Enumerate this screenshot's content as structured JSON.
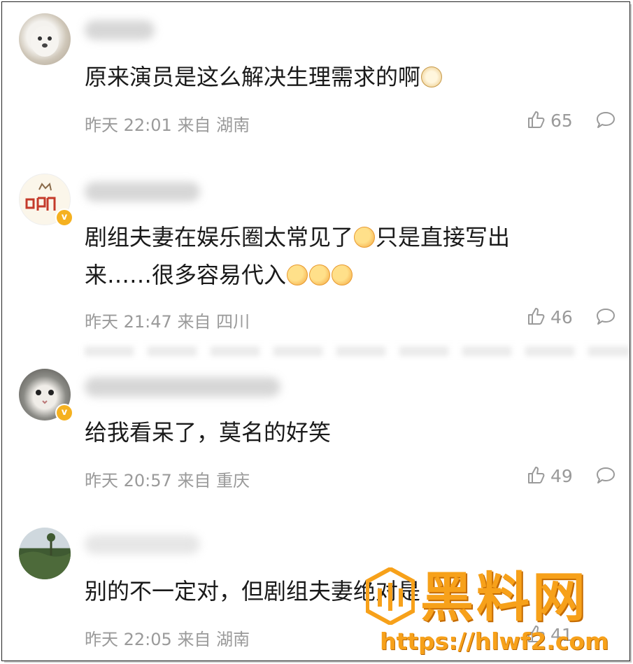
{
  "comments": [
    {
      "text": "原来演员是这么解决生理需求的啊",
      "emoji_tail": "doge-emoji",
      "time": "昨天 22:01",
      "source": "来自 湖南",
      "likes": "65",
      "verified": false
    },
    {
      "text_line1": "剧组夫妻在娱乐圈太常见了",
      "text_line1b": "只是直接写出",
      "text_line2": "来……很多容易代入",
      "emoji_tail": "drooling-emoji",
      "time": "昨天 21:47",
      "source": "来自 四川",
      "likes": "46",
      "verified": true
    },
    {
      "text": "给我看呆了，莫名的好笑",
      "time": "昨天 20:57",
      "source": "来自 重庆",
      "likes": "49",
      "verified": true
    },
    {
      "text": "别的不一定对，但剧组夫妻绝对是",
      "time": "昨天 22:05",
      "source": "来自 湖南",
      "likes": "41",
      "verified": false
    }
  ],
  "watermark": {
    "title": "黑料网",
    "url": "https://hlwf2.com"
  },
  "colors": {
    "text": "#1a1a1a",
    "meta": "#9a9a9a",
    "verified_badge": "#f5b120",
    "watermark": "#f7a11a"
  }
}
